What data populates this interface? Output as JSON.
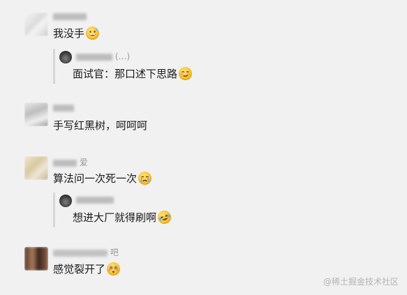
{
  "comments": [
    {
      "author_suffix": "",
      "text": "我没手",
      "emoji": "grinning-sweat-emoji",
      "reply": {
        "author_suffix": "(…)",
        "text": "面试官：那口述下思路",
        "emoji": "smirk-emoji"
      }
    },
    {
      "author_suffix": "",
      "text": "手写红黑树，呵呵呵",
      "emoji": ""
    },
    {
      "author_suffix": "爱",
      "text": "算法问一次死一次",
      "emoji": "crying-emoji",
      "reply": {
        "author_suffix": "",
        "text": "想进大厂就得刷啊",
        "emoji": "laughing-tears-emoji"
      }
    },
    {
      "author_suffix": "吧",
      "text": "感觉裂开了",
      "emoji": "flushed-emoji"
    }
  ],
  "watermark": "@稀土掘金技术社区",
  "colors": {
    "background": "#f1f1f1",
    "name": "#9a9a9a",
    "text": "#1a1a1a",
    "quote_bar": "#d6d6d6"
  }
}
